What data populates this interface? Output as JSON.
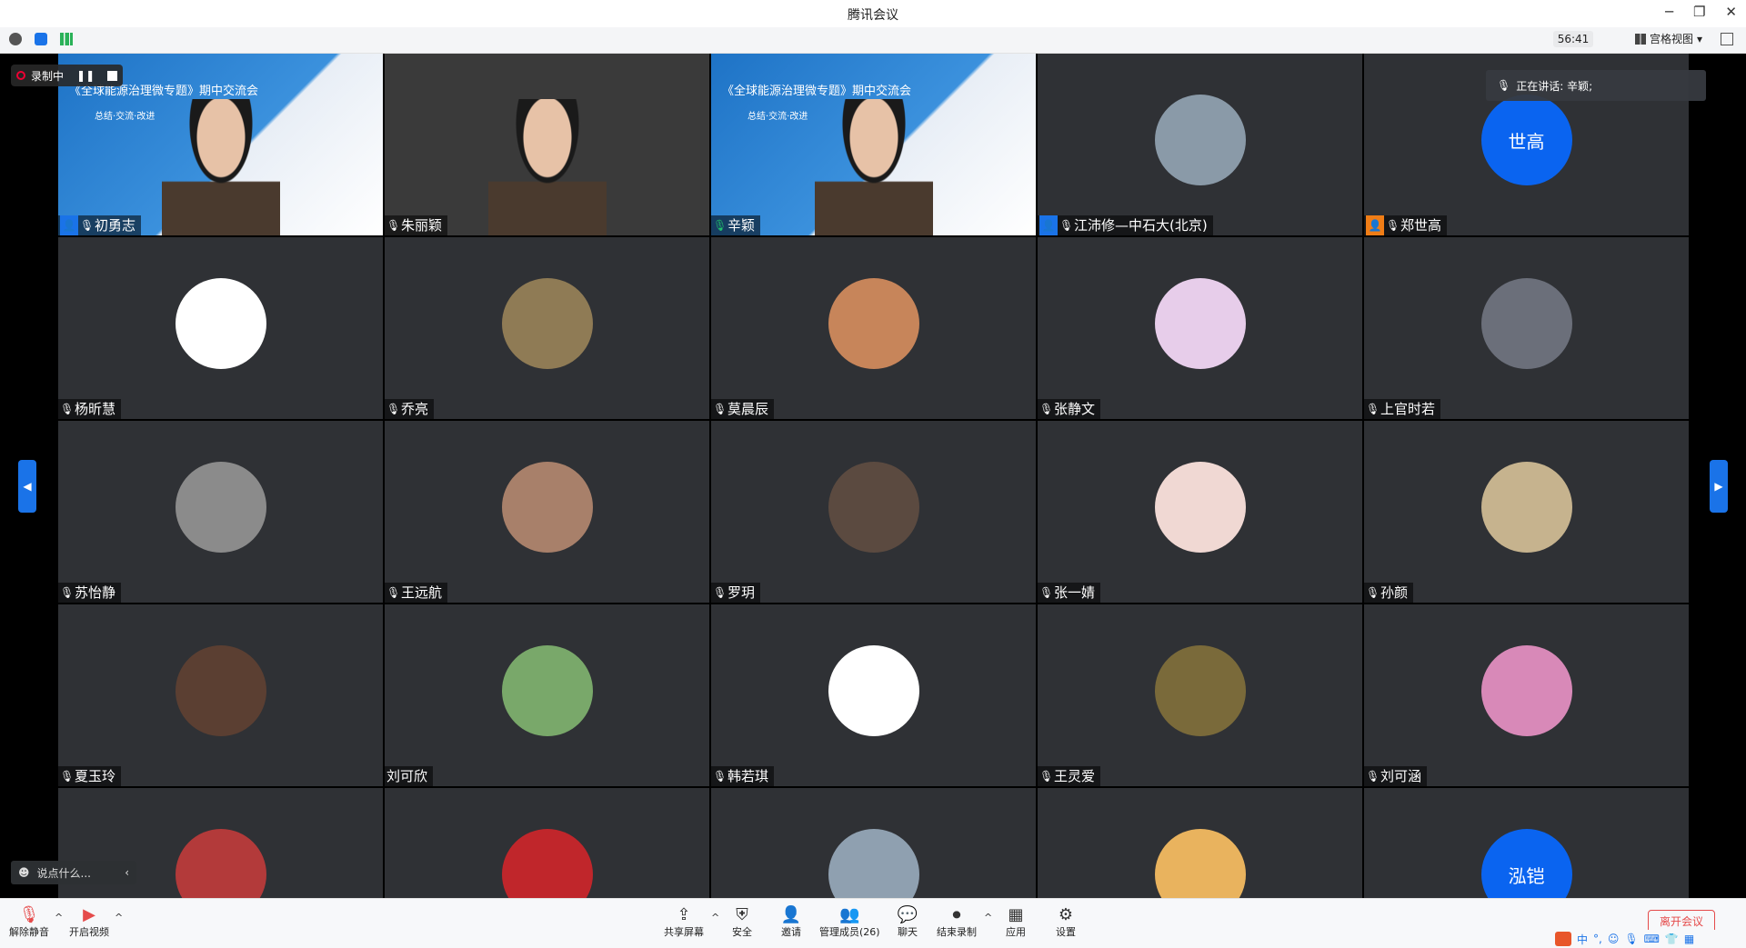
{
  "window": {
    "title": "腾讯会议",
    "controls": [
      "─",
      "❐",
      "✕"
    ]
  },
  "infobar": {
    "timer": "56:41",
    "view_label": "宫格视图"
  },
  "recording": {
    "label": "录制中"
  },
  "speaking": {
    "label": "正在讲话: 辛颖;"
  },
  "participants": [
    {
      "name": "初勇志",
      "role": "host",
      "kind": "video"
    },
    {
      "name": "朱丽颖",
      "role": "",
      "kind": "video"
    },
    {
      "name": "辛颖",
      "role": "",
      "kind": "video",
      "speaking": true
    },
    {
      "name": "江沛修—中石大(北京)",
      "role": "host",
      "color": "#8a9aa8"
    },
    {
      "name": "郑世高",
      "role": "cohost",
      "color": "#0a64f0",
      "avatar_text": "世高"
    },
    {
      "name": "杨昕慧",
      "color": "#ffffff"
    },
    {
      "name": "乔亮",
      "color": "#8f7b55"
    },
    {
      "name": "莫晨辰",
      "color": "#c7855a"
    },
    {
      "name": "张静文",
      "color": "#e7cdea"
    },
    {
      "name": "上官时若",
      "color": "#6b6f7a"
    },
    {
      "name": "苏怡静",
      "color": "#8b8b8b"
    },
    {
      "name": "王远航",
      "color": "#a8806a"
    },
    {
      "name": "罗玥",
      "color": "#5b4a40"
    },
    {
      "name": "张一婧",
      "color": "#f0d8d3"
    },
    {
      "name": "孙颜",
      "color": "#c6b38e"
    },
    {
      "name": "夏玉玲",
      "color": "#5b3f32"
    },
    {
      "name": "刘可欣",
      "color": "#79a86a",
      "no_mic": true
    },
    {
      "name": "韩若琪",
      "color": "#ffffff"
    },
    {
      "name": "王灵爱",
      "color": "#7a6a3a"
    },
    {
      "name": "刘可涵",
      "color": "#d889b8"
    },
    {
      "name": "",
      "color": "#b33a3a"
    },
    {
      "name": "",
      "color": "#c0262b"
    },
    {
      "name": "",
      "color": "#8fa0b0"
    },
    {
      "name": "",
      "color": "#e9b35e"
    },
    {
      "name": "",
      "color": "#0a64f0",
      "avatar_text": "泓铠"
    }
  ],
  "slide": {
    "title": "《全球能源治理微专题》期中交流会",
    "subtitle": "总结·交流·改进"
  },
  "chat": {
    "placeholder": "说点什么..."
  },
  "toolbar": {
    "unmute": "解除静音",
    "start_video": "开启视频",
    "share_screen": "共享屏幕",
    "security": "安全",
    "invite": "邀请",
    "manage_members": "管理成员(26)",
    "chat": "聊天",
    "end_recording": "结束录制",
    "apps": "应用",
    "settings": "设置",
    "leave": "离开会议"
  },
  "ime": {
    "label": "中"
  },
  "colors": {
    "accent": "#1a73e8",
    "danger": "#e54b4b",
    "tile_bg": "#2f3135",
    "speaking_border": "#22c06b"
  }
}
